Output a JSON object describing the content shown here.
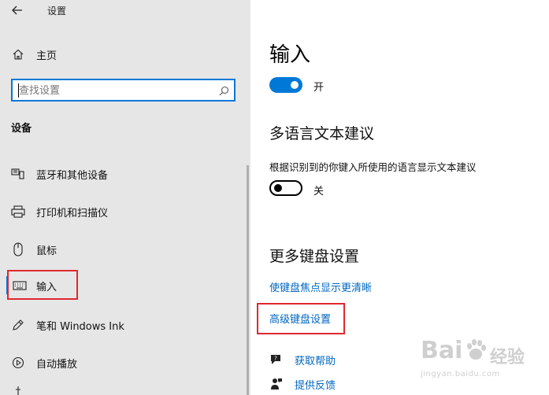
{
  "window": {
    "title": "设置"
  },
  "sidebar": {
    "home_label": "主页",
    "search": {
      "value": "",
      "placeholder": "查找设置"
    },
    "section_title": "设备",
    "items": [
      {
        "label": "蓝牙和其他设备",
        "icon": "bluetooth-devices-icon"
      },
      {
        "label": "打印机和扫描仪",
        "icon": "printer-icon"
      },
      {
        "label": "鼠标",
        "icon": "mouse-icon"
      },
      {
        "label": "输入",
        "icon": "keyboard-icon",
        "selected": true
      },
      {
        "label": "笔和 Windows Ink",
        "icon": "pen-icon"
      },
      {
        "label": "自动播放",
        "icon": "autoplay-icon"
      }
    ]
  },
  "main": {
    "title": "输入",
    "input_toggle": {
      "state": "on",
      "label": "开"
    },
    "multilingual": {
      "heading": "多语言文本建议",
      "description": "根据识别到的你键入所使用的语言显示文本建议",
      "toggle": {
        "state": "off",
        "label": "关"
      }
    },
    "more_keyboard": {
      "heading": "更多键盘设置",
      "links": [
        "使键盘焦点显示更清晰",
        "高级键盘设置"
      ]
    },
    "help": {
      "get_help": "获取帮助",
      "feedback": "提供反馈"
    }
  },
  "watermark": {
    "logo": "Bai",
    "logo_suffix": "经验",
    "url": "jingyan.baidu.com"
  },
  "colors": {
    "accent": "#0078d7",
    "link": "#0067c0",
    "highlight_box": "#e0272f",
    "sidebar_bg": "#e6e6e6"
  }
}
